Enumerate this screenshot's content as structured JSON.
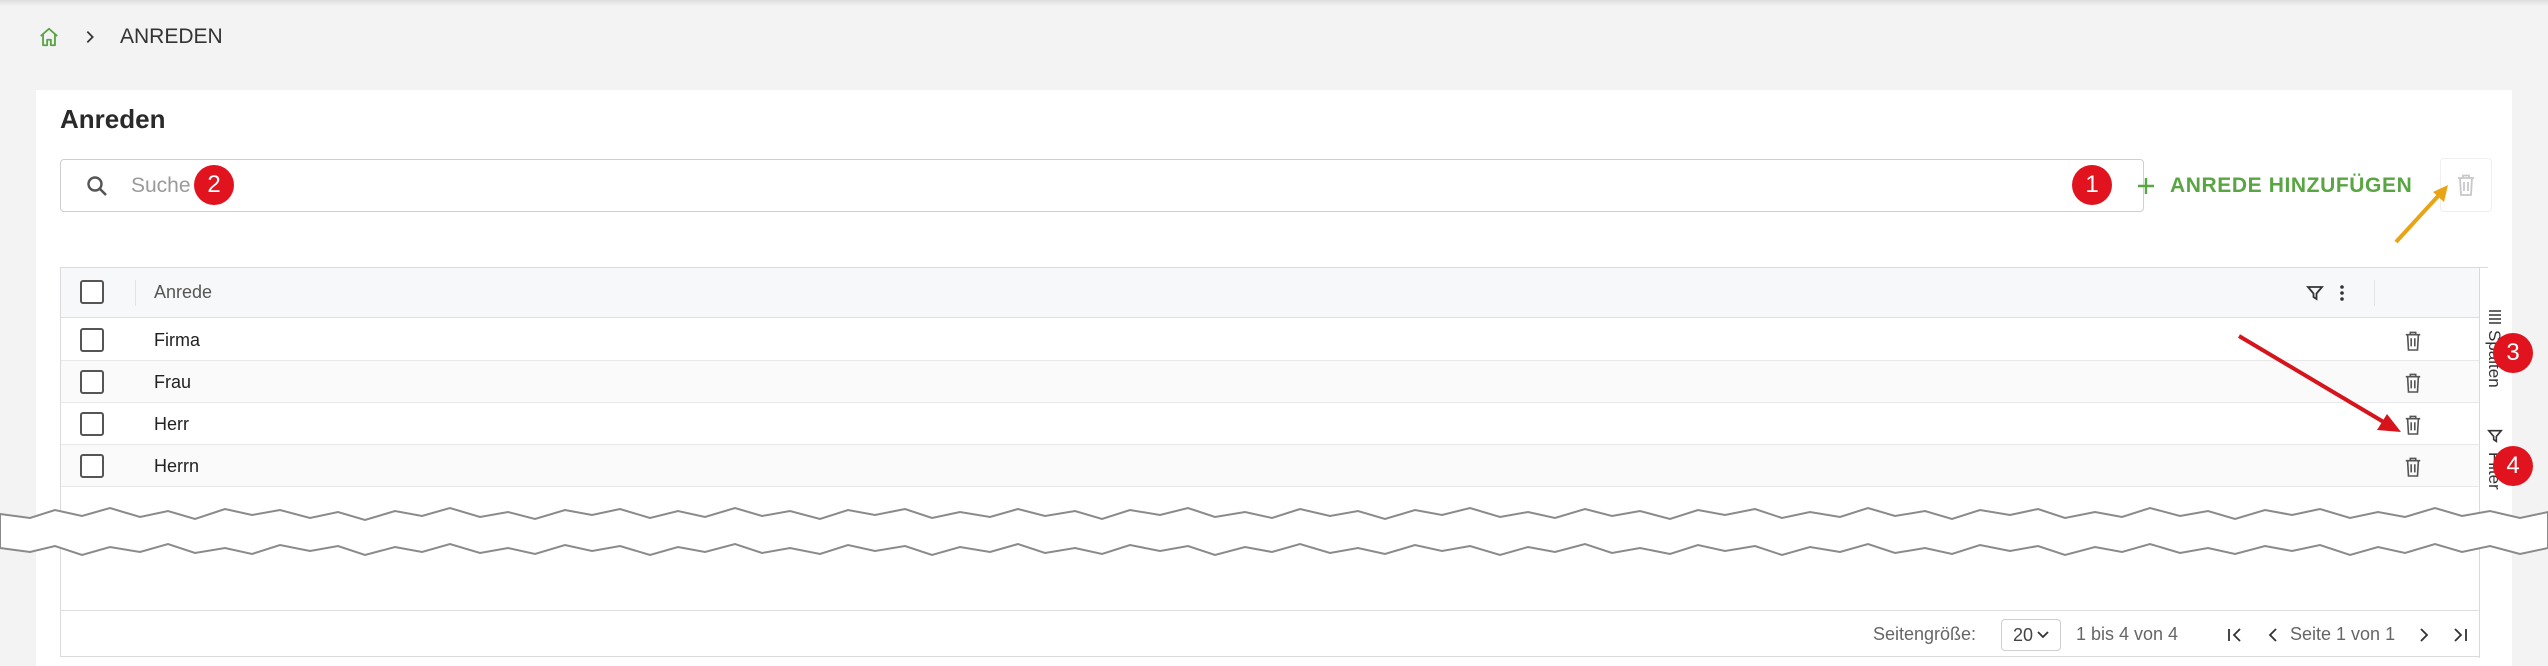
{
  "breadcrumb": {
    "home_icon": "home-icon",
    "separator_icon": "chevron-right-icon",
    "current": "ANREDEN"
  },
  "page": {
    "title": "Anreden"
  },
  "search": {
    "placeholder": "Suche",
    "icon": "search-icon"
  },
  "toolbar": {
    "add_label": "ANREDE HINZUFÜGEN",
    "add_icon": "plus-icon",
    "delete_icon": "trash-icon"
  },
  "annotations": {
    "badge1": "1",
    "badge2": "2",
    "badge3": "3",
    "badge4": "4"
  },
  "grid": {
    "columns": [
      {
        "label": "Anrede"
      }
    ],
    "rows": [
      {
        "anrede": "Firma"
      },
      {
        "anrede": "Frau"
      },
      {
        "anrede": "Herr"
      },
      {
        "anrede": "Herrn"
      }
    ],
    "side_panels": {
      "columns": "Spalten",
      "filter": "Filter"
    }
  },
  "pagination": {
    "page_size_label": "Seitengröße:",
    "page_size_value": "20",
    "range": "1 bis 4 von 4",
    "page_info": "Seite 1 von 1"
  },
  "colors": {
    "accent_green": "#59a543",
    "badge_red": "#e0131f",
    "arrow_orange": "#e8a415",
    "arrow_red": "#d6141c"
  }
}
